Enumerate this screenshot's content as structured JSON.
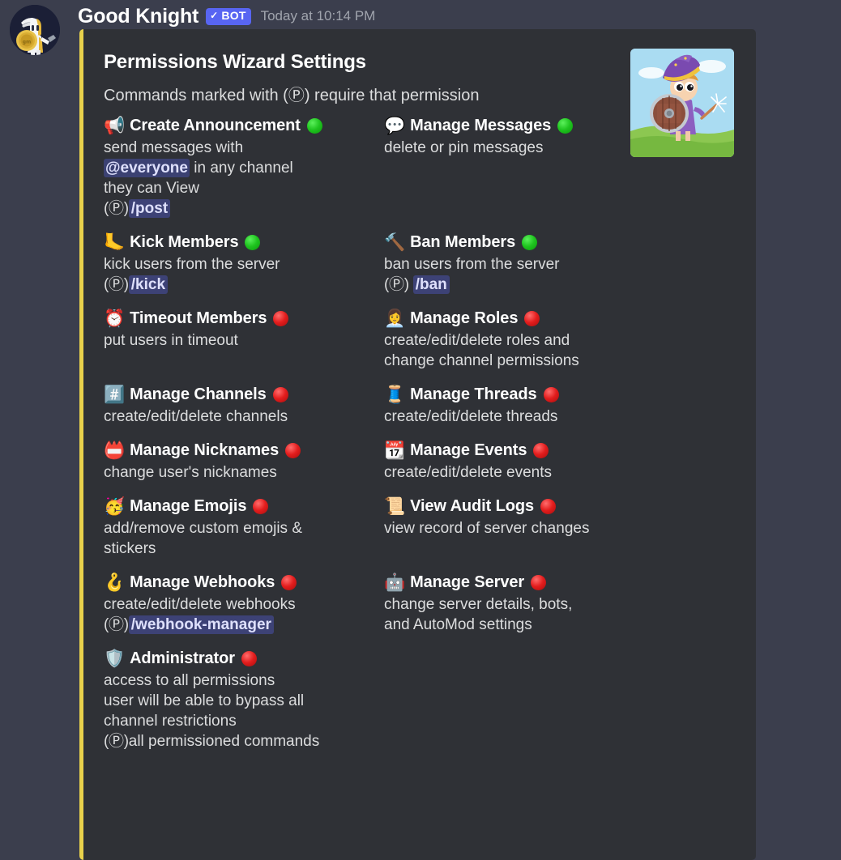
{
  "message": {
    "author": "Good Knight",
    "bot_badge": "BOT",
    "bot_badge_check": "✓",
    "timestamp": "Today at 10:14 PM",
    "avatar_name": "good-knight-avatar"
  },
  "embed": {
    "accent_color": "#E8D14B",
    "background_color": "#2F3136",
    "title": "Permissions Wizard Settings",
    "description": "Commands marked with (Ⓟ) require that permission",
    "thumbnail_alt": "wizard knight character with shield and wand",
    "permission_marker": "(Ⓟ)",
    "status_colors": {
      "enabled": "#1FC41F",
      "disabled": "#E31D1D"
    },
    "mention_color": "#DEE0FC",
    "fields": [
      {
        "name": "Create Announcement",
        "emoji": "📢",
        "emoji_name": "loudspeaker-icon",
        "status": "green",
        "lines": [
          {
            "text": "send messages with"
          },
          {
            "parts": [
              {
                "type": "mention",
                "text": "@everyone"
              },
              {
                "type": "text",
                "text": " in any channel"
              }
            ]
          },
          {
            "text": "they can View"
          },
          {
            "parts": [
              {
                "type": "pmark",
                "text": "(Ⓟ)"
              },
              {
                "type": "cmd",
                "text": "/post"
              }
            ]
          }
        ]
      },
      {
        "name": "Manage Messages",
        "emoji": "💬",
        "emoji_name": "speech-balloon-icon",
        "status": "green",
        "lines": [
          {
            "text": "delete or pin messages"
          }
        ]
      },
      {
        "name": "Kick Members",
        "emoji": "🦶",
        "emoji_name": "foot-icon",
        "status": "green",
        "lines": [
          {
            "text": "kick users from the server"
          },
          {
            "parts": [
              {
                "type": "pmark",
                "text": "(Ⓟ)"
              },
              {
                "type": "cmd",
                "text": "/kick"
              }
            ]
          }
        ]
      },
      {
        "name": "Ban Members",
        "emoji": "🔨",
        "emoji_name": "hammer-icon",
        "status": "green",
        "lines": [
          {
            "text": "ban users from the server"
          },
          {
            "parts": [
              {
                "type": "pmark",
                "text": "(Ⓟ) "
              },
              {
                "type": "cmd",
                "text": "/ban"
              }
            ]
          }
        ]
      },
      {
        "name": "Timeout Members",
        "emoji": "⏰",
        "emoji_name": "alarm-clock-icon",
        "status": "red",
        "lines": [
          {
            "text": "put users in timeout"
          }
        ]
      },
      {
        "name": "Manage Roles",
        "emoji": "👩‍💼",
        "emoji_name": "office-worker-icon",
        "status": "red",
        "lines": [
          {
            "text": "create/edit/delete roles and"
          },
          {
            "text": "change channel permissions"
          }
        ]
      },
      {
        "name": "Manage Channels",
        "emoji": "#️⃣",
        "emoji_name": "hash-icon",
        "status": "red",
        "lines": [
          {
            "text": "create/edit/delete channels"
          }
        ]
      },
      {
        "name": "Manage Threads",
        "emoji": "🧵",
        "emoji_name": "thread-spool-icon",
        "status": "red",
        "lines": [
          {
            "text": "create/edit/delete threads"
          }
        ]
      },
      {
        "name": "Manage Nicknames",
        "emoji": "📛",
        "emoji_name": "name-badge-icon",
        "status": "red",
        "lines": [
          {
            "text": "change user's nicknames"
          }
        ]
      },
      {
        "name": "Manage Events",
        "emoji": "📆",
        "emoji_name": "calendar-icon",
        "status": "red",
        "lines": [
          {
            "text": "create/edit/delete events"
          }
        ]
      },
      {
        "name": "Manage Emojis",
        "emoji": "🥳",
        "emoji_name": "partying-face-icon",
        "status": "red",
        "lines": [
          {
            "text": "add/remove custom emojis &"
          },
          {
            "text": "stickers"
          }
        ]
      },
      {
        "name": "View Audit Logs",
        "emoji": "📜",
        "emoji_name": "scroll-icon",
        "status": "red",
        "lines": [
          {
            "text": "view record of server changes"
          }
        ]
      },
      {
        "name": "Manage Webhooks",
        "emoji": "🪝",
        "emoji_name": "hook-icon",
        "status": "red",
        "lines": [
          {
            "text": "create/edit/delete webhooks"
          },
          {
            "parts": [
              {
                "type": "pmark",
                "text": "(Ⓟ)"
              },
              {
                "type": "cmd",
                "text": "/webhook-manager"
              }
            ]
          }
        ]
      },
      {
        "name": "Manage Server",
        "emoji": "🤖",
        "emoji_name": "robot-icon",
        "status": "red",
        "lines": [
          {
            "text": "change server details, bots,"
          },
          {
            "text": "and AutoMod settings"
          }
        ]
      },
      {
        "name": "Administrator",
        "emoji": "🛡️",
        "emoji_name": "shield-icon",
        "status": "red",
        "lines": [
          {
            "text": "access to all permissions"
          },
          {
            "text": "user will be able to bypass all"
          },
          {
            "text": "channel restrictions"
          },
          {
            "parts": [
              {
                "type": "pmark",
                "text": "(Ⓟ)"
              },
              {
                "type": "text",
                "text": "all permissioned commands"
              }
            ]
          }
        ]
      }
    ]
  }
}
